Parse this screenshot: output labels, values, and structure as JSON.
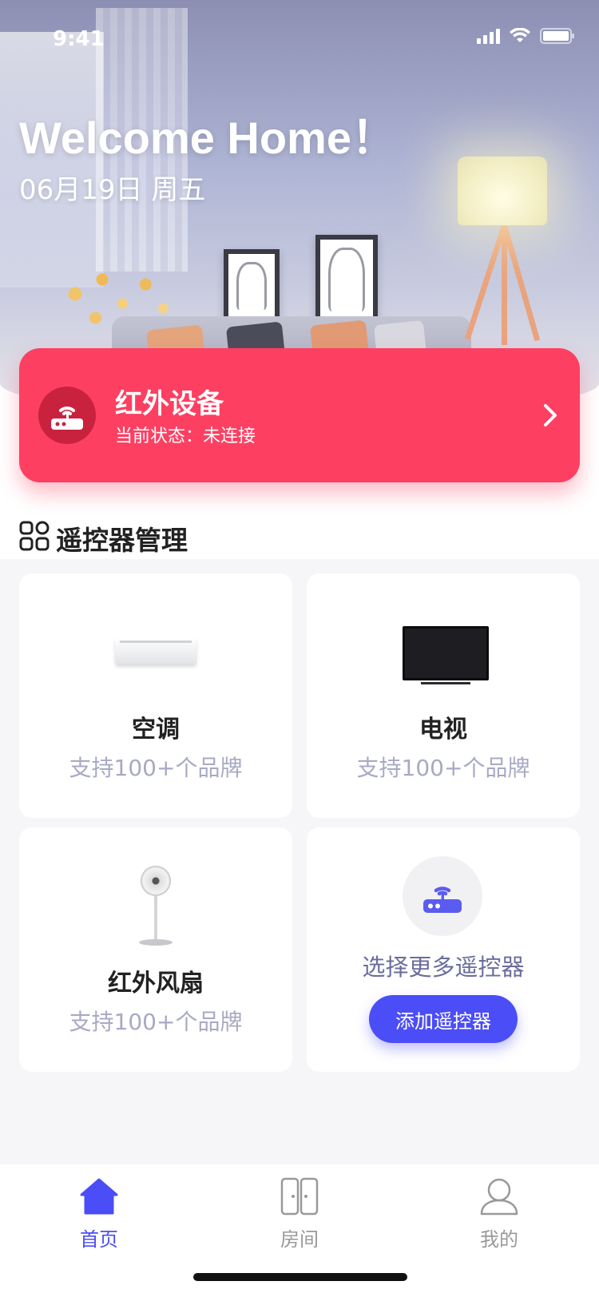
{
  "status_bar": {
    "time": "9:41"
  },
  "header": {
    "title": "Welcome Home！",
    "date": "06月19日 周五"
  },
  "ir_device": {
    "title": "红外设备",
    "status": "当前状态：未连接",
    "icon": "router-icon",
    "accent": "#fd3f62"
  },
  "section": {
    "title": "遥控器管理",
    "icon": "apps-icon"
  },
  "remotes": [
    {
      "name": "空调",
      "brands": "支持100+个品牌",
      "icon": "air-conditioner"
    },
    {
      "name": "电视",
      "brands": "支持100+个品牌",
      "icon": "tv"
    },
    {
      "name": "红外风扇",
      "brands": "支持100+个品牌",
      "icon": "fan"
    }
  ],
  "more": {
    "text": "选择更多遥控器",
    "button": "添加遥控器",
    "icon": "router-icon",
    "accent": "#4b4df7"
  },
  "tabs": [
    {
      "label": "首页",
      "icon": "home-icon",
      "active": true
    },
    {
      "label": "房间",
      "icon": "door-icon",
      "active": false
    },
    {
      "label": "我的",
      "icon": "user-icon",
      "active": false
    }
  ]
}
